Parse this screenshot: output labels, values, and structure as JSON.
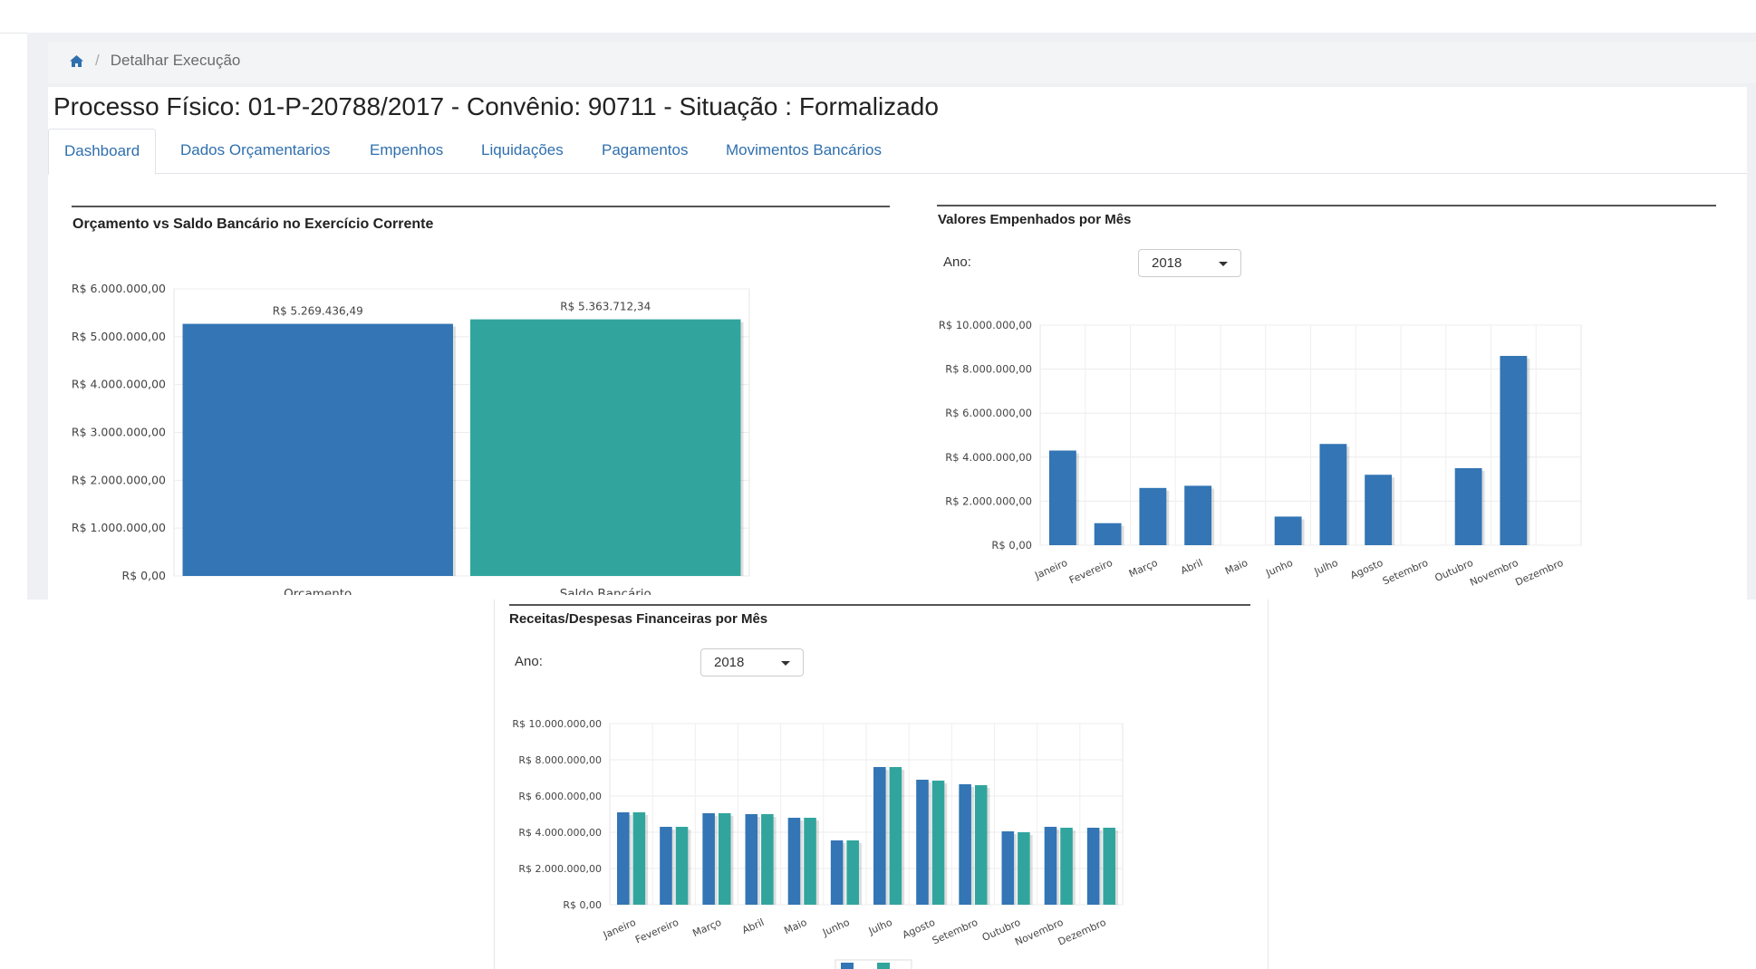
{
  "breadcrumb": {
    "home_icon": "home-icon",
    "current": "Detalhar Execução"
  },
  "page_title": "Processo Físico: 01-P-20788/2017 - Convênio: 90711 - Situação : Formalizado",
  "tabs": [
    {
      "label": "Dashboard",
      "active": true
    },
    {
      "label": "Dados Orçamentarios",
      "active": false
    },
    {
      "label": "Empenhos",
      "active": false
    },
    {
      "label": "Liquidações",
      "active": false
    },
    {
      "label": "Pagamentos",
      "active": false
    },
    {
      "label": "Movimentos Bancários",
      "active": false
    }
  ],
  "colors": {
    "blue": "#3375b5",
    "teal": "#31a59d",
    "link": "#2f6fad"
  },
  "panels": {
    "orcamento": {
      "title": "Orçamento vs Saldo Bancário no Exercício Corrente"
    },
    "empenhos": {
      "title": "Valores Empenhados por Mês",
      "ano_label": "Ano:",
      "ano_value": "2018"
    },
    "financeiras": {
      "title": "Receitas/Despesas Financeiras por Mês",
      "ano_label": "Ano:",
      "ano_value": "2018"
    }
  },
  "chart_data": [
    {
      "type": "bar",
      "title": "Orçamento vs Saldo Bancário no Exercício Corrente",
      "categories": [
        "Orçamento",
        "Saldo Bancário"
      ],
      "values": [
        5269436.49,
        5363712.34
      ],
      "data_labels": [
        "R$ 5.269.436,49",
        "R$ 5.363.712,34"
      ],
      "colors": [
        "#3375b5",
        "#31a59d"
      ],
      "ylim": [
        0,
        6000000
      ],
      "yticks": [
        0,
        1000000,
        2000000,
        3000000,
        4000000,
        5000000,
        6000000
      ],
      "ytick_labels": [
        "R$ 0,00",
        "R$ 1.000.000,00",
        "R$ 2.000.000,00",
        "R$ 3.000.000,00",
        "R$ 4.000.000,00",
        "R$ 5.000.000,00",
        "R$ 6.000.000,00"
      ],
      "grid": true
    },
    {
      "type": "bar",
      "title": "Valores Empenhados por Mês",
      "categories": [
        "Janeiro",
        "Fevereiro",
        "Março",
        "Abril",
        "Maio",
        "Junho",
        "Julho",
        "Agosto",
        "Setembro",
        "Outubro",
        "Novembro",
        "Dezembro"
      ],
      "values": [
        4300000,
        1000000,
        2600000,
        2700000,
        0,
        1300000,
        4600000,
        3200000,
        0,
        3500000,
        8600000,
        0
      ],
      "color": "#3375b5",
      "ylim": [
        0,
        10000000
      ],
      "yticks": [
        0,
        2000000,
        4000000,
        6000000,
        8000000,
        10000000
      ],
      "ytick_labels": [
        "R$ 0,00",
        "R$ 2.000.000,00",
        "R$ 4.000.000,00",
        "R$ 6.000.000,00",
        "R$ 8.000.000,00",
        "R$ 10.000.000,00"
      ],
      "grid": true
    },
    {
      "type": "bar",
      "title": "Receitas/Despesas Financeiras por Mês",
      "categories": [
        "Janeiro",
        "Fevereiro",
        "Março",
        "Abril",
        "Maio",
        "Junho",
        "Julho",
        "Agosto",
        "Setembro",
        "Outubro",
        "Novembro",
        "Dezembro"
      ],
      "series": [
        {
          "values": [
            5100000,
            4300000,
            5050000,
            5000000,
            4800000,
            3550000,
            7600000,
            6900000,
            6650000,
            4050000,
            4300000,
            4250000
          ],
          "color": "#3375b5"
        },
        {
          "values": [
            5100000,
            4300000,
            5050000,
            5000000,
            4800000,
            3550000,
            7600000,
            6850000,
            6600000,
            4000000,
            4250000,
            4250000
          ],
          "color": "#31a59d"
        }
      ],
      "ylim": [
        0,
        10000000
      ],
      "yticks": [
        0,
        2000000,
        4000000,
        6000000,
        8000000,
        10000000
      ],
      "ytick_labels": [
        "R$ 0,00",
        "R$ 2.000.000,00",
        "R$ 4.000.000,00",
        "R$ 6.000.000,00",
        "R$ 8.000.000,00",
        "R$ 10.000.000,00"
      ],
      "grid": true,
      "legend": "bottom"
    }
  ]
}
